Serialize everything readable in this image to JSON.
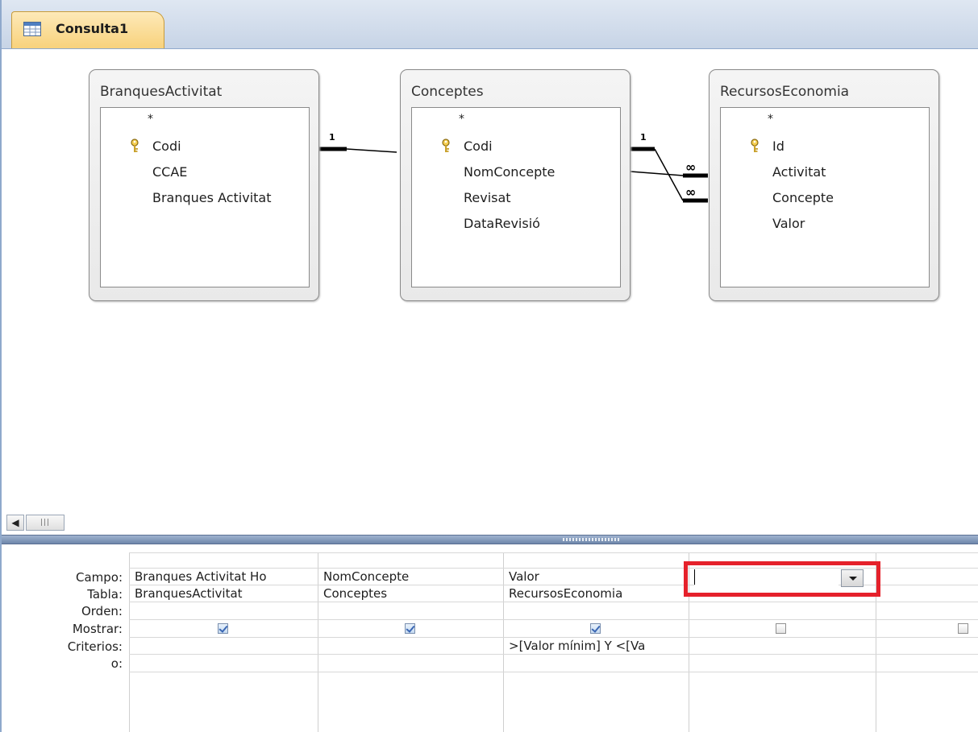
{
  "tab": {
    "title": "Consulta1"
  },
  "tables": [
    {
      "name": "BranquesActivitat",
      "fields": [
        "*",
        "Codi",
        "CCAE",
        "Branques Activitat"
      ],
      "key_index": 1
    },
    {
      "name": "Conceptes",
      "fields": [
        "*",
        "Codi",
        "NomConcepte",
        "Revisat",
        "DataRevisió"
      ],
      "key_index": 1
    },
    {
      "name": "RecursosEconomia",
      "fields": [
        "*",
        "Id",
        "Activitat",
        "Concepte",
        "Valor"
      ],
      "key_index": 1
    }
  ],
  "relationships": [
    {
      "one_label": "1",
      "many_label": "∞"
    },
    {
      "one_label": "1",
      "many_label": "∞"
    }
  ],
  "grid": {
    "row_labels": {
      "campo": "Campo:",
      "tabla": "Tabla:",
      "orden": "Orden:",
      "mostrar": "Mostrar:",
      "criterios": "Criterios:",
      "o": "o:"
    },
    "columns": [
      {
        "campo": "Branques Activitat Ho",
        "tabla": "BranquesActivitat",
        "orden": "",
        "mostrar": true,
        "criterios": "",
        "o": ""
      },
      {
        "campo": "NomConcepte",
        "tabla": "Conceptes",
        "orden": "",
        "mostrar": true,
        "criterios": "",
        "o": ""
      },
      {
        "campo": "Valor",
        "tabla": "RecursosEconomia",
        "orden": "",
        "mostrar": true,
        "criterios": ">[Valor mínim] Y <[Va",
        "o": ""
      },
      {
        "campo": "",
        "tabla": "",
        "orden": "",
        "mostrar": false,
        "criterios": "",
        "o": ""
      },
      {
        "campo": "",
        "tabla": "",
        "orden": "",
        "mostrar": false,
        "criterios": "",
        "o": ""
      }
    ]
  },
  "colors": {
    "highlight": "#e5212b",
    "tab": "#f8d27c",
    "splitter": "#7f95b8"
  },
  "icons": [
    "query-icon",
    "primary-key-icon",
    "scroll-left-icon",
    "dropdown-arrow-icon"
  ]
}
